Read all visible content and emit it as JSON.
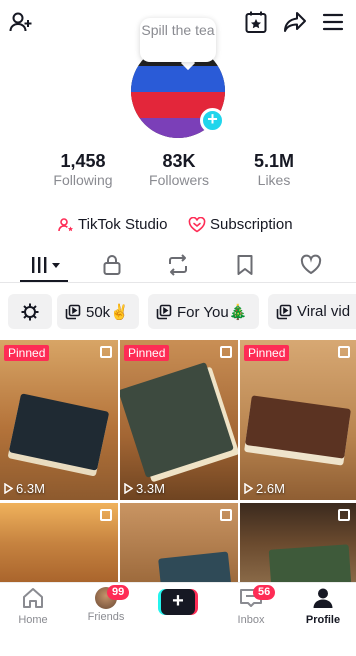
{
  "avatar_note": "Spill the tea",
  "stats": [
    {
      "value": "1,458",
      "label": "Following"
    },
    {
      "value": "83K",
      "label": "Followers"
    },
    {
      "value": "5.1M",
      "label": "Likes"
    }
  ],
  "links": {
    "studio": "TikTok Studio",
    "subscription": "Subscription"
  },
  "chips": [
    "50k✌️",
    "For You🎄",
    "Viral vid"
  ],
  "videos": [
    {
      "pinned": "Pinned",
      "views": "6.3M"
    },
    {
      "pinned": "Pinned",
      "views": "3.3M"
    },
    {
      "pinned": "Pinned",
      "views": "2.6M"
    },
    {
      "pinned": "",
      "views": ""
    },
    {
      "pinned": "",
      "views": ""
    },
    {
      "pinned": "",
      "views": ""
    }
  ],
  "nav": {
    "home": "Home",
    "friends": "Friends",
    "friends_badge": "99",
    "inbox": "Inbox",
    "inbox_badge": "56",
    "profile": "Profile",
    "create": "+"
  },
  "colors": {
    "accent": "#fe2c55",
    "accent2": "#25f4ee",
    "plus": "#20d5ec",
    "text": "#161823",
    "muted": "#8a8b91"
  }
}
